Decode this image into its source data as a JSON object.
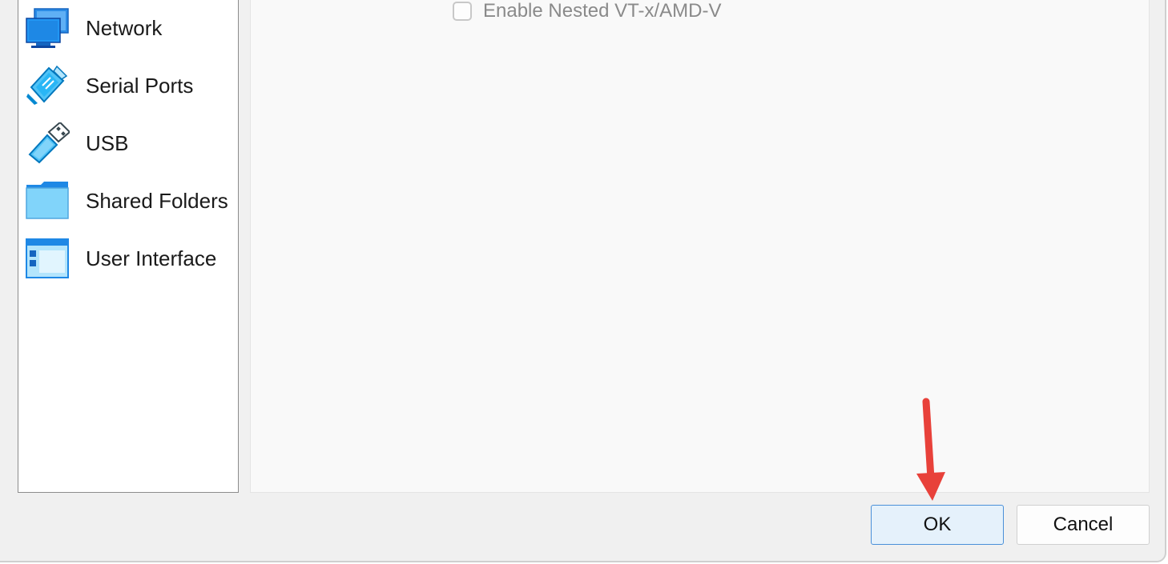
{
  "sidebar": {
    "items": [
      {
        "label": "Network",
        "icon": "network-icon"
      },
      {
        "label": "Serial Ports",
        "icon": "serial-port-icon"
      },
      {
        "label": "USB",
        "icon": "usb-icon"
      },
      {
        "label": "Shared Folders",
        "icon": "shared-folder-icon"
      },
      {
        "label": "User Interface",
        "icon": "user-interface-icon"
      }
    ]
  },
  "content": {
    "nested_vtx_label": "Enable Nested VT-x/AMD-V",
    "nested_vtx_checked": false
  },
  "buttons": {
    "ok_label": "OK",
    "cancel_label": "Cancel"
  },
  "annotation": {
    "arrow_color": "#e8413a"
  },
  "colors": {
    "accent_blue": "#1e88e5",
    "ok_button_bg": "#e5f1fb",
    "ok_button_border": "#4a90d9"
  }
}
